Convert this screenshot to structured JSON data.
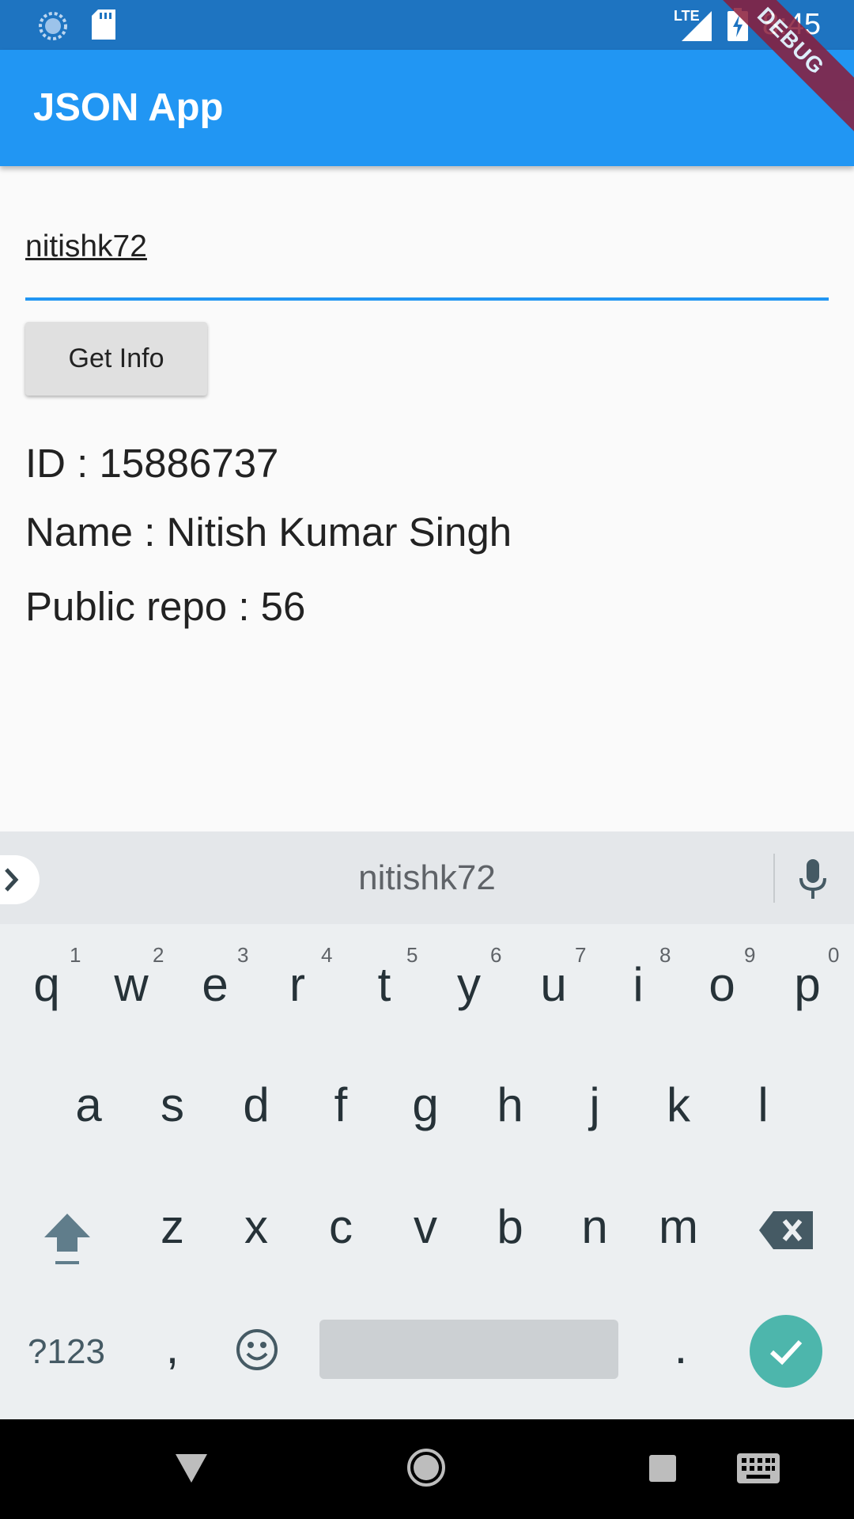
{
  "status_bar": {
    "time": "8:45",
    "network": "LTE"
  },
  "app_bar": {
    "title": "JSON App",
    "debug_banner": "DEBUG"
  },
  "form": {
    "username_value": "nitishk72",
    "button_label": "Get Info"
  },
  "info": {
    "id_text": "ID : 15886737",
    "name_text": "Name : Nitish Kumar Singh",
    "repo_text": "Public repo : 56"
  },
  "keyboard": {
    "suggestion": "nitishk72",
    "row1": [
      "q",
      "w",
      "e",
      "r",
      "t",
      "y",
      "u",
      "i",
      "o",
      "p"
    ],
    "row1_hints": [
      "1",
      "2",
      "3",
      "4",
      "5",
      "6",
      "7",
      "8",
      "9",
      "0"
    ],
    "row2": [
      "a",
      "s",
      "d",
      "f",
      "g",
      "h",
      "j",
      "k",
      "l"
    ],
    "row3": [
      "z",
      "x",
      "c",
      "v",
      "b",
      "n",
      "m"
    ],
    "symbols_label": "?123",
    "comma": ",",
    "period": "."
  },
  "colors": {
    "primary": "#2196f3",
    "status": "#1e74c1",
    "enter": "#4db6ac"
  }
}
